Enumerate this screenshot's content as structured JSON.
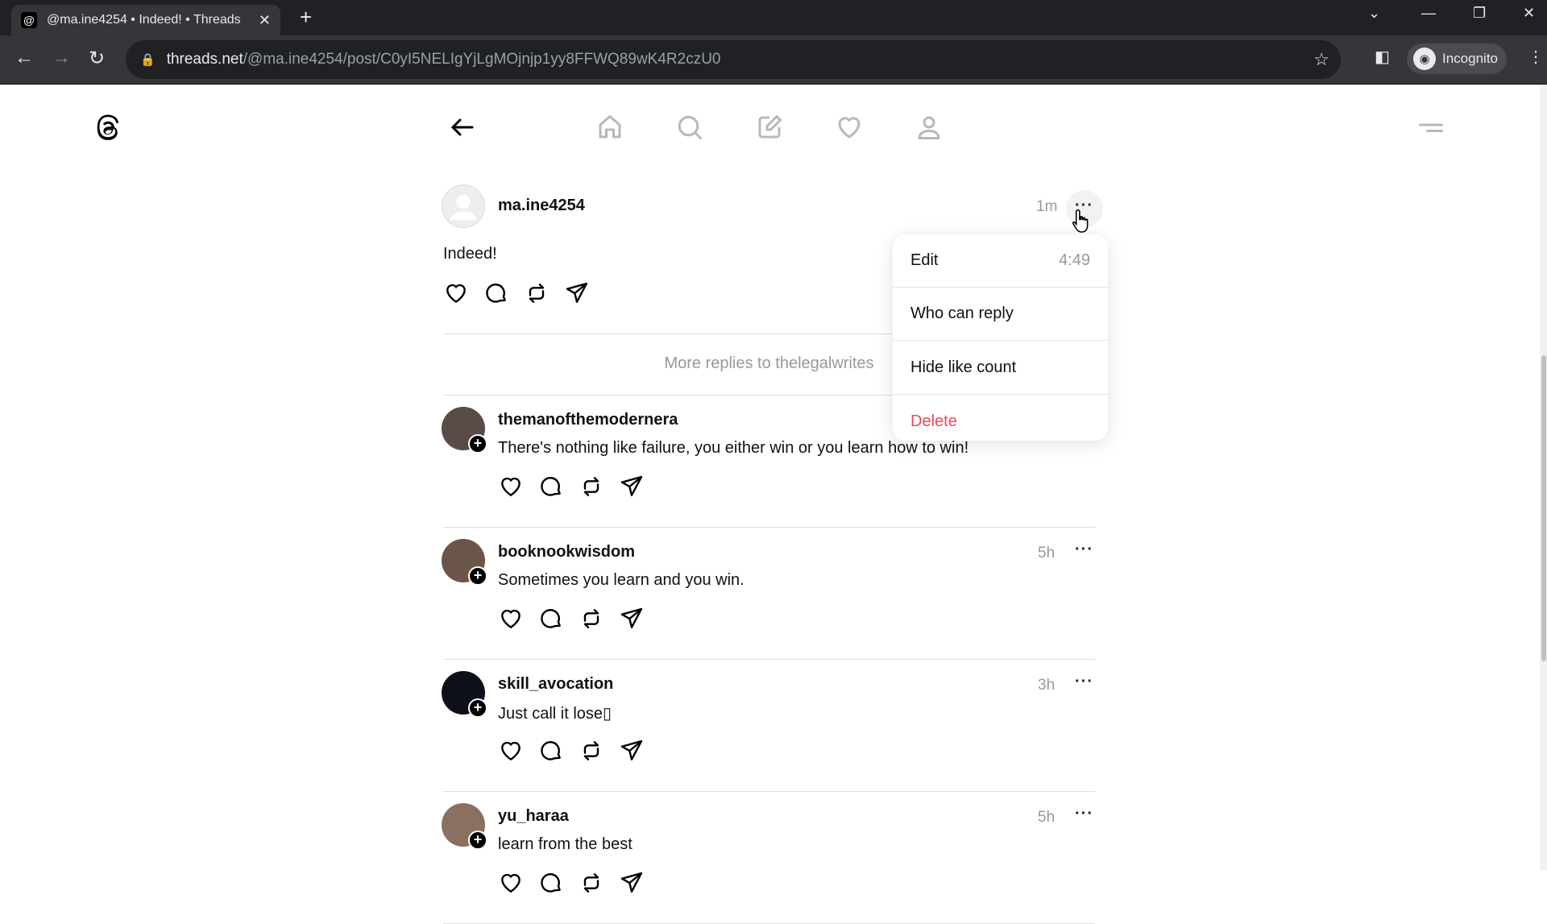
{
  "browser": {
    "tab_title": "@ma.ine4254 • Indeed! • Threads",
    "url_host": "threads.net",
    "url_path": "/@ma.ine4254/post/C0yI5NELIgYjLgMOjnjp1yy8FFWQ89wK4R2czU0",
    "profile": "Incognito"
  },
  "nav": {
    "icons": [
      "back-arrow",
      "home",
      "search",
      "compose",
      "heart",
      "profile"
    ]
  },
  "main_post": {
    "username": "ma.ine4254",
    "time": "1m",
    "text": "Indeed!"
  },
  "menu": {
    "items": [
      {
        "label": "Edit",
        "meta": "4:49"
      },
      {
        "label": "Who can reply",
        "meta": ""
      },
      {
        "label": "Hide like count",
        "meta": ""
      },
      {
        "label": "Delete",
        "meta": ""
      }
    ],
    "delete_color": "#ed4956"
  },
  "more_replies": "More replies to thelegalwrites",
  "replies": [
    {
      "username": "themanofthemodernera",
      "time": "",
      "text": "There's nothing like failure, you either win or you learn how to win!",
      "avatar_color": "#5a4a48"
    },
    {
      "username": "booknookwisdom",
      "time": "5h",
      "text": "Sometimes you learn and you win.",
      "avatar_color": "#6b5448"
    },
    {
      "username": "skill_avocation",
      "time": "3h",
      "text": "Just call it lose▯",
      "avatar_color": "#0d1018"
    },
    {
      "username": "yu_haraa",
      "time": "5h",
      "text": "learn from the best",
      "avatar_color": "#8a7060"
    }
  ]
}
